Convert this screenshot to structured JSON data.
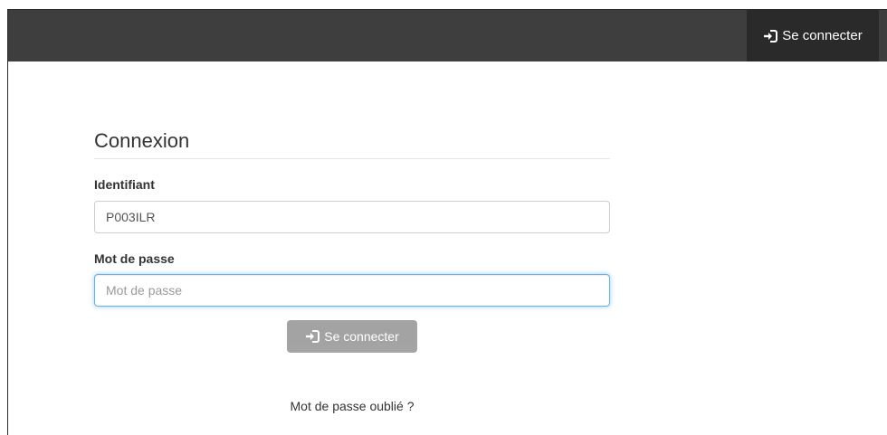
{
  "navbar": {
    "login_label": "Se connecter",
    "login_icon": "sign-in-icon",
    "background": "#3e3e3e"
  },
  "form": {
    "title": "Connexion",
    "username_label": "Identifiant",
    "username_value": "P003ILR",
    "password_label": "Mot de passe",
    "password_placeholder": "Mot de passe",
    "submit_label": "Se connecter",
    "submit_icon": "sign-in-icon",
    "forgot_link": "Mot de passe oublié ?"
  },
  "colors": {
    "navbar": "#3e3e3e",
    "navbar_active": "#2a2a2a",
    "focus_border": "#66afe9",
    "button": "#9a9a9a"
  }
}
